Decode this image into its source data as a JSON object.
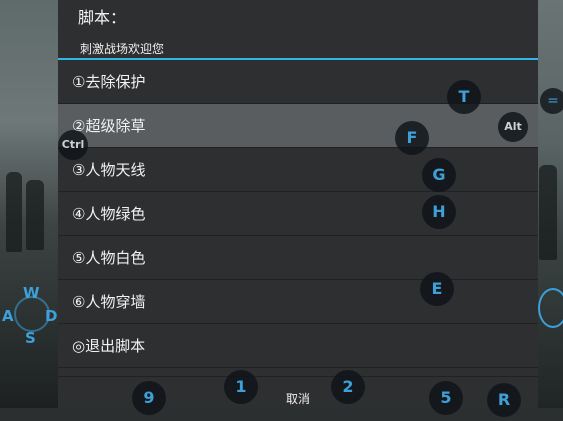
{
  "dialog": {
    "title": "脚本：",
    "message": "刺激战场欢迎您",
    "items": [
      {
        "label": "①去除保护"
      },
      {
        "label": "②超级除草"
      },
      {
        "label": "③人物天线"
      },
      {
        "label": "④人物绿色"
      },
      {
        "label": "⑤人物白色"
      },
      {
        "label": "⑥人物穿墙"
      },
      {
        "label": "◎退出脚本"
      }
    ],
    "cancel_label": "取消",
    "highlighted_index": 1
  },
  "keys": {
    "t": "T",
    "alt": "Alt",
    "f": "F",
    "ctrl": "Ctrl",
    "g": "G",
    "h": "H",
    "e": "E",
    "k9": "9",
    "k1": "1",
    "k2": "2",
    "k5": "5",
    "r": "R",
    "w": "W",
    "a": "A",
    "s": "S",
    "d": "D",
    "right_glyph": "="
  },
  "colors": {
    "accent": "#33b5e5",
    "dialog_bg": "#2d2f31",
    "highlight_bg": "#5a5d60",
    "key_text": "#3da0d8"
  }
}
